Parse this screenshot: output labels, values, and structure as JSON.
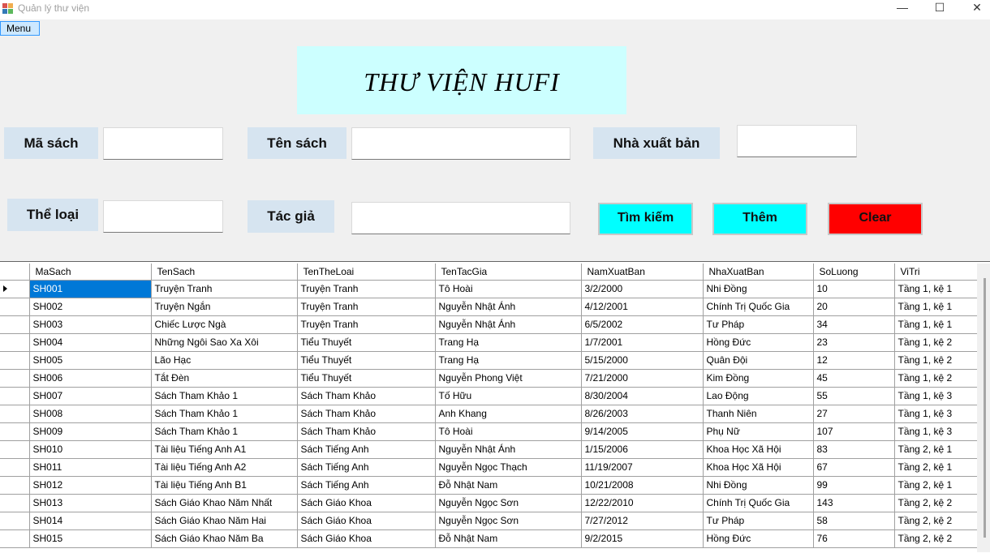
{
  "window": {
    "title": "Quản lý thư viện",
    "minimize": "—",
    "maximize": "☐",
    "close": "✕"
  },
  "menu": {
    "label": "Menu"
  },
  "banner": {
    "title": "THƯ VIỆN HUFI"
  },
  "form": {
    "ma_sach_label": "Mã sách",
    "ten_sach_label": "Tên sách",
    "nha_xuat_ban_label": "Nhà xuất bản",
    "the_loai_label": "Thể loại",
    "tac_gia_label": "Tác giả",
    "ma_sach_value": "",
    "ten_sach_value": "",
    "nha_xuat_ban_value": "",
    "the_loai_value": "",
    "tac_gia_value": ""
  },
  "buttons": {
    "search": "Tìm kiếm",
    "add": "Thêm",
    "clear": "Clear"
  },
  "colors": {
    "banner_bg": "#ccffff",
    "label_bg": "#d6e4f0",
    "search_bg": "#00ffff",
    "add_bg": "#00ffff",
    "clear_bg": "#ff0000",
    "selection": "#0078d7"
  },
  "grid": {
    "columns": [
      "MaSach",
      "TenSach",
      "TenTheLoai",
      "TenTacGia",
      "NamXuatBan",
      "NhaXuatBan",
      "SoLuong",
      "ViTri"
    ],
    "rows": [
      [
        "SH001",
        "Truyện Tranh",
        "Truyện Tranh",
        "Tô Hoài",
        "3/2/2000",
        "Nhi Đồng",
        "10",
        "Tầng 1, kệ 1"
      ],
      [
        "SH002",
        "Truyện Ngắn",
        "Truyện Tranh",
        "Nguyễn Nhật Ánh",
        "4/12/2001",
        "Chính Trị Quốc Gia",
        "20",
        "Tầng 1, kệ 1"
      ],
      [
        "SH003",
        "Chiếc Lược Ngà",
        "Truyện Tranh",
        "Nguyễn Nhật Ánh",
        "6/5/2002",
        "Tư Pháp",
        "34",
        "Tầng 1, kệ 1"
      ],
      [
        "SH004",
        "Những Ngôi Sao Xa Xôi",
        "Tiểu Thuyết",
        "Trang Hạ",
        "1/7/2001",
        "Hồng Đức",
        "23",
        "Tầng 1, kệ 2"
      ],
      [
        "SH005",
        "Lão Hạc",
        "Tiểu Thuyết",
        "Trang Hạ",
        "5/15/2000",
        "Quân Đội",
        "12",
        "Tầng 1, kệ 2"
      ],
      [
        "SH006",
        "Tắt Đèn",
        "Tiểu Thuyết",
        "Nguyễn Phong Việt",
        "7/21/2000",
        "Kim Đồng",
        "45",
        "Tầng 1, kệ 2"
      ],
      [
        "SH007",
        "Sách Tham Khảo 1",
        "Sách Tham Khảo",
        "Tố Hữu",
        "8/30/2004",
        "Lao Động",
        "55",
        "Tầng 1, kệ 3"
      ],
      [
        "SH008",
        "Sách Tham Khảo 1",
        "Sách Tham Khảo",
        "Anh Khang",
        "8/26/2003",
        "Thanh Niên",
        "27",
        "Tầng 1, kệ 3"
      ],
      [
        "SH009",
        "Sách Tham Khảo 1",
        "Sách Tham Khảo",
        "Tô Hoài",
        "9/14/2005",
        "Phụ Nữ",
        "107",
        "Tầng 1, kệ 3"
      ],
      [
        "SH010",
        "Tài liệu Tiếng Anh A1",
        "Sách Tiếng Anh",
        "Nguyễn Nhật Ánh",
        "1/15/2006",
        "Khoa Học Xã Hội",
        "83",
        "Tầng 2, kệ 1"
      ],
      [
        "SH011",
        "Tài liệu Tiếng Anh A2",
        "Sách Tiếng Anh",
        "Nguyễn Ngọc Thạch",
        "11/19/2007",
        "Khoa Học Xã Hội",
        "67",
        "Tầng 2, kệ 1"
      ],
      [
        "SH012",
        "Tài liệu Tiếng Anh B1",
        "Sách Tiếng Anh",
        "Đỗ Nhật Nam",
        "10/21/2008",
        "Nhi Đồng",
        "99",
        "Tầng 2, kệ 1"
      ],
      [
        "SH013",
        "Sách Giáo Khao Năm Nhất",
        "Sách Giáo Khoa",
        "Nguyễn Ngọc Sơn",
        "12/22/2010",
        "Chính Trị Quốc Gia",
        "143",
        "Tầng 2, kệ 2"
      ],
      [
        "SH014",
        "Sách Giáo Khao Năm Hai",
        "Sách Giáo Khoa",
        "Nguyễn Ngọc Sơn",
        "7/27/2012",
        "Tư Pháp",
        "58",
        "Tầng 2, kệ 2"
      ],
      [
        "SH015",
        "Sách Giáo Khao Năm Ba",
        "Sách Giáo Khoa",
        "Đỗ Nhật Nam",
        "9/2/2015",
        "Hồng Đức",
        "76",
        "Tầng 2, kệ 2"
      ]
    ]
  }
}
